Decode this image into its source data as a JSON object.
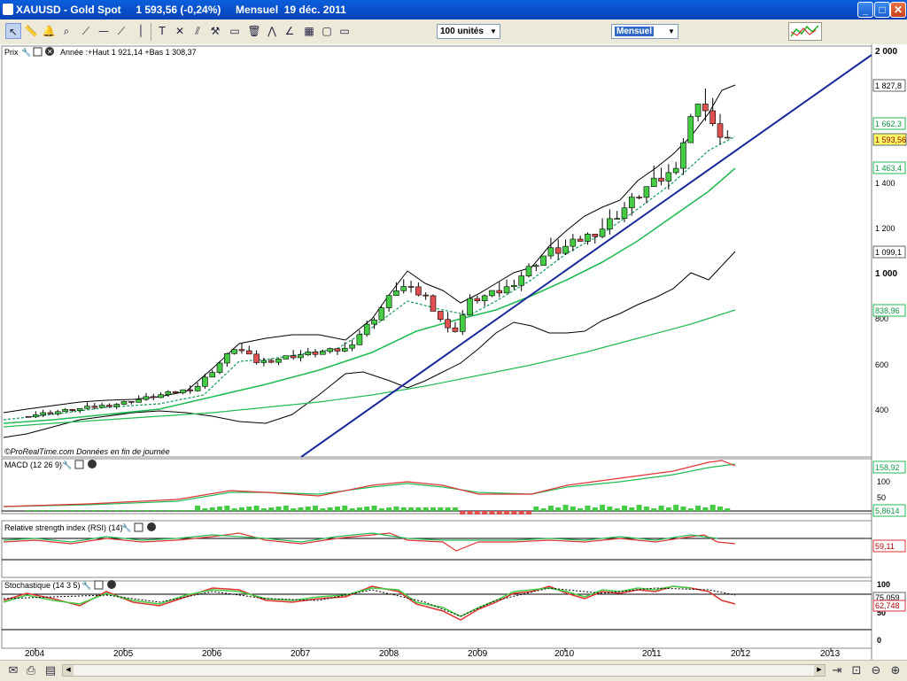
{
  "window": {
    "title": "XAUUSD - Gold Spot     1 593,56 (-0,24%)     Mensuel  19 déc. 2011",
    "minimize": "_",
    "maximize": "□",
    "close": "✕"
  },
  "toolbar": {
    "tools": [
      "pointer-icon",
      "ruler-icon",
      "alarm-bell-icon",
      "zoom-icon",
      "line-tool-icon",
      "horizontal-line-icon",
      "trendline-icon",
      "vertical-line-icon",
      "text-tool-icon",
      "fibonacci-icon",
      "parallel-lines-icon",
      "hammer-icon",
      "channel-icon",
      "delete-icon",
      "fan-icon",
      "grid-icon",
      "rectangle-icon",
      "ellipse-icon"
    ],
    "units_value": "100 unités",
    "period_value": "Mensuel"
  },
  "price_panel": {
    "title": "Prix",
    "legend": "Année :+Haut 1 921,14 +Bas 1 308,37",
    "watermark": "©ProRealTime.com  Données en fin de journée",
    "y_ticks": [
      "2 000",
      "1 400",
      "1 200",
      "1 000",
      "800",
      "600",
      "400"
    ],
    "value_tags": [
      {
        "label": "1 827,8",
        "color": "#ffffff"
      },
      {
        "label": "1 662,3",
        "color": "#ffffff"
      },
      {
        "label": "1 593,56",
        "color": "#ffff66"
      },
      {
        "label": "1 463,4",
        "color": "#ffffff"
      },
      {
        "label": "1 099,1",
        "color": "#ffffff"
      },
      {
        "label": "838,96",
        "color": "#ffffff"
      }
    ]
  },
  "macd_panel": {
    "title": "MACD (12 26 9)",
    "y_ticks": [
      "100",
      "50"
    ],
    "value_tags": [
      {
        "label": "158,92"
      },
      {
        "label": "5,8614"
      }
    ]
  },
  "rsi_panel": {
    "title": "Relative strength index (RSI) (14)",
    "value_tags": [
      {
        "label": "59,11"
      }
    ]
  },
  "stoch_panel": {
    "title": "Stochastique (14 3 5)",
    "y_ticks": [
      "100",
      "50",
      "0"
    ],
    "value_tags": [
      {
        "label": "75,059"
      },
      {
        "label": "62,748"
      }
    ]
  },
  "x_axis": {
    "labels": [
      "2004",
      "2005",
      "2006",
      "2007",
      "2008",
      "2009",
      "2010",
      "2011",
      "2012",
      "2013"
    ]
  },
  "colors": {
    "up": "#44cc44",
    "down": "#e05050",
    "trendline": "#1a2a9a",
    "ma_green": "#22bb55",
    "bollinger": "#000000"
  },
  "chart_data": {
    "type": "candlestick",
    "instrument": "XAUUSD - Gold Spot",
    "period": "Mensuel",
    "x_range": [
      2004,
      2013
    ],
    "y_range": [
      350,
      2000
    ],
    "candles_yearly_close": [
      {
        "date": "2004",
        "close": 410
      },
      {
        "date": "2005",
        "close": 440
      },
      {
        "date": "2006",
        "close": 630
      },
      {
        "date": "2007",
        "close": 650
      },
      {
        "date": "2008",
        "close": 880
      },
      {
        "date": "2009",
        "close": 1000
      },
      {
        "date": "2010",
        "close": 1300
      },
      {
        "date": "2011",
        "close": 1593.56
      }
    ],
    "last_close": 1593.56,
    "year_high": 1921.14,
    "year_low": 1308.37
  }
}
